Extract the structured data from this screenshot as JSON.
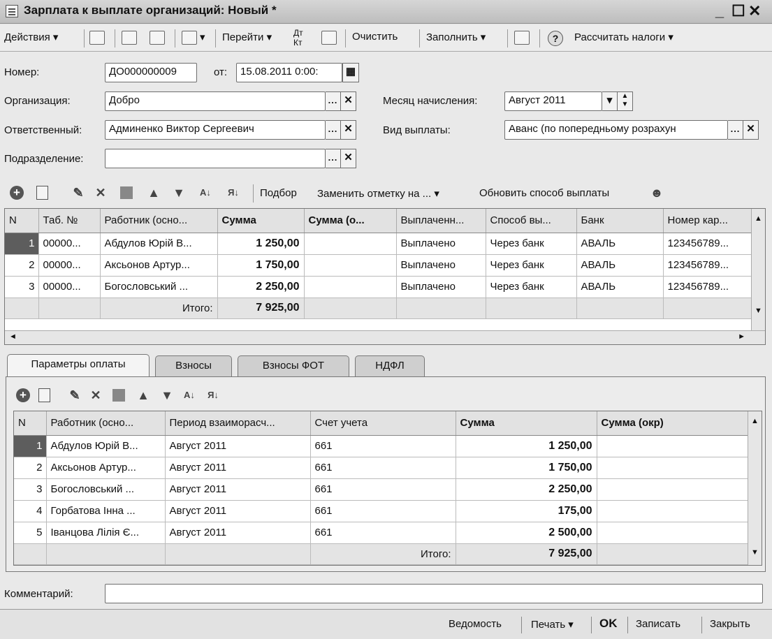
{
  "window": {
    "title": "Зарплата к выплате организаций: Новый *"
  },
  "toolbar": {
    "actions": "Действия",
    "goto": "Перейти",
    "clear": "Очистить",
    "fill": "Заполнить",
    "calc_taxes": "Рассчитать налоги"
  },
  "form": {
    "number_label": "Номер:",
    "number_value": "ДО000000009",
    "date_label": "от:",
    "date_value": "15.08.2011 0:00:",
    "org_label": "Организация:",
    "org_value": "Добро",
    "month_label": "Месяц начисления:",
    "month_value": "Август 2011",
    "resp_label": "Ответственный:",
    "resp_value": "Админенко Виктор Сергеевич",
    "paytype_label": "Вид выплаты:",
    "paytype_value": "Аванс (по попередньому розрахун",
    "dept_label": "Подразделение:",
    "dept_value": ""
  },
  "grid_toolbar": {
    "select": "Подбор",
    "replace_mark": "Заменить отметку на ...",
    "refresh_pay": "Обновить способ выплаты"
  },
  "top_grid": {
    "columns": [
      "N",
      "Таб. №",
      "Работник (осно...",
      "Сумма",
      "Сумма (о...",
      "Выплаченн...",
      "Способ вы...",
      "Банк",
      "Номер кар..."
    ],
    "rows": [
      {
        "n": "1",
        "tab": "00000...",
        "worker": "Абдулов Юрій В...",
        "sum": "1 250,00",
        "sum_o": "",
        "paid": "Выплачено",
        "method": "Через банк",
        "bank": "АВАЛЬ",
        "card": "123456789..."
      },
      {
        "n": "2",
        "tab": "00000...",
        "worker": "Аксьонов Артур...",
        "sum": "1 750,00",
        "sum_o": "",
        "paid": "Выплачено",
        "method": "Через банк",
        "bank": "АВАЛЬ",
        "card": "123456789..."
      },
      {
        "n": "3",
        "tab": "00000...",
        "worker": "Богословський ...",
        "sum": "2 250,00",
        "sum_o": "",
        "paid": "Выплачено",
        "method": "Через банк",
        "bank": "АВАЛЬ",
        "card": "123456789..."
      }
    ],
    "total_label": "Итого:",
    "total_value": "7 925,00"
  },
  "tabs": [
    "Параметры оплаты",
    "Взносы",
    "Взносы ФОТ",
    "НДФЛ"
  ],
  "bottom_grid": {
    "columns": [
      "N",
      "Работник (осно...",
      "Период взаиморасч...",
      "Счет учета",
      "Сумма",
      "Сумма (окр)"
    ],
    "rows": [
      {
        "n": "1",
        "worker": "Абдулов Юрій В...",
        "period": "Август 2011",
        "account": "661",
        "sum": "1 250,00",
        "sum_r": ""
      },
      {
        "n": "2",
        "worker": "Аксьонов Артур...",
        "period": "Август 2011",
        "account": "661",
        "sum": "1 750,00",
        "sum_r": ""
      },
      {
        "n": "3",
        "worker": "Богословський ...",
        "period": "Август 2011",
        "account": "661",
        "sum": "2 250,00",
        "sum_r": ""
      },
      {
        "n": "4",
        "worker": "Горбатова Інна ...",
        "period": "Август 2011",
        "account": "661",
        "sum": "175,00",
        "sum_r": ""
      },
      {
        "n": "5",
        "worker": "Іванцова Лілія Є...",
        "period": "Август 2011",
        "account": "661",
        "sum": "2 500,00",
        "sum_r": ""
      }
    ],
    "total_label": "Итого:",
    "total_value": "7 925,00"
  },
  "comment": {
    "label": "Комментарий:",
    "value": ""
  },
  "bottom_bar": {
    "statement": "Ведомость",
    "print": "Печать",
    "ok": "OK",
    "save": "Записать",
    "close": "Закрыть"
  }
}
